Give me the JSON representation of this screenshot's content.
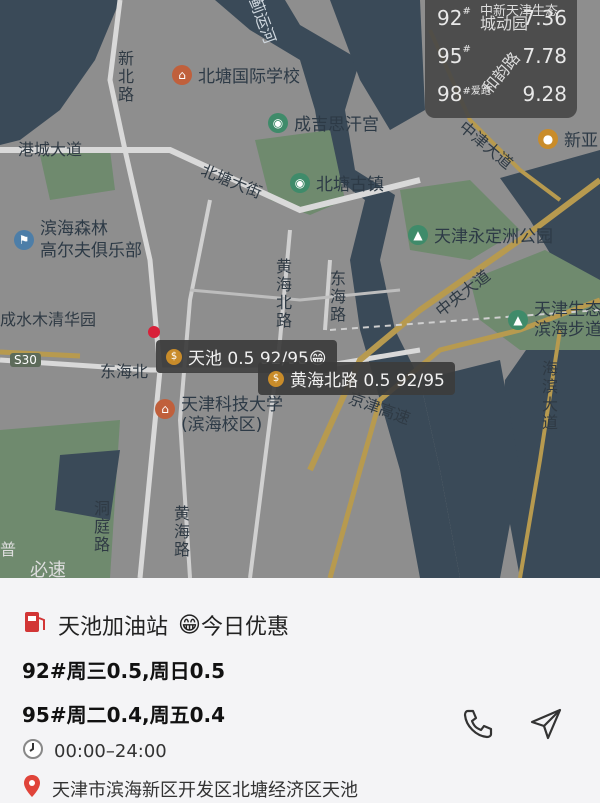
{
  "map": {
    "price_box": {
      "rows": [
        {
          "grade": "92",
          "suffix": "#",
          "value": "7.36"
        },
        {
          "grade": "95",
          "suffix": "#",
          "value": "7.78"
        },
        {
          "grade": "98",
          "suffix": "#爱跑",
          "value": "9.28"
        }
      ]
    },
    "pois": {
      "beitang_school": "北塘国际学校",
      "chengjisi": "成吉思汗宫",
      "beitang_town": "北塘古镇",
      "yongdingzhou": "天津永定洲公园",
      "golf_line1": "滨海森林",
      "golf_line2": "高尔夫俱乐部",
      "tech_univ_line1": "天津科技大学",
      "tech_univ_line2": "(滨海校区)",
      "eco_line1": "天津生态",
      "eco_line2": "滨海步道",
      "xinya": "新亚",
      "chengdu_park": "城动园",
      "shuimu": "成水木清华园",
      "top_partial": "中新天津生态"
    },
    "roads": {
      "gangcheng": "港城大道",
      "beitang_st": "北塘大街",
      "donghai_rd_h": "东海北",
      "xinbei": "新北路",
      "huanghai_n": "黄海北路",
      "donghai_n": "东海路",
      "zhongyang": "中央大道",
      "zhongtian": "中津大道",
      "hefeng": "和韵路",
      "jingjin": "京津高速",
      "haibin": "海滨大道",
      "tuo": "拓",
      "jiting": "洞庭路",
      "huanghai_s": "黄海路",
      "s30": "S30",
      "jiyun": "蓟运河",
      "pu": "普",
      "bi": "必速"
    },
    "tags": {
      "tianchi": "天池 0.5 92/95😁",
      "huanghai": "黄海北路 0.5 92/95"
    }
  },
  "station": {
    "name": "天池加油站",
    "emoji": "😁",
    "promo_label": "今日优惠",
    "promo_92": "92#周三0.5,周日0.5",
    "promo_95": "95#周二0.4,周五0.4",
    "hours": "00:00–24:00",
    "address": "天津市滨海新区开发区北塘经济区天池"
  },
  "icons": [
    "gas-pump-icon",
    "clock-icon",
    "location-pin-icon",
    "phone-icon",
    "navigate-icon"
  ],
  "colors": {
    "water": "#3a4a58",
    "land": "#8e8e8e",
    "green": "#6f8a6e",
    "road_yellow": "#b79a4f",
    "sheet_bg": "#f4f4f6"
  }
}
